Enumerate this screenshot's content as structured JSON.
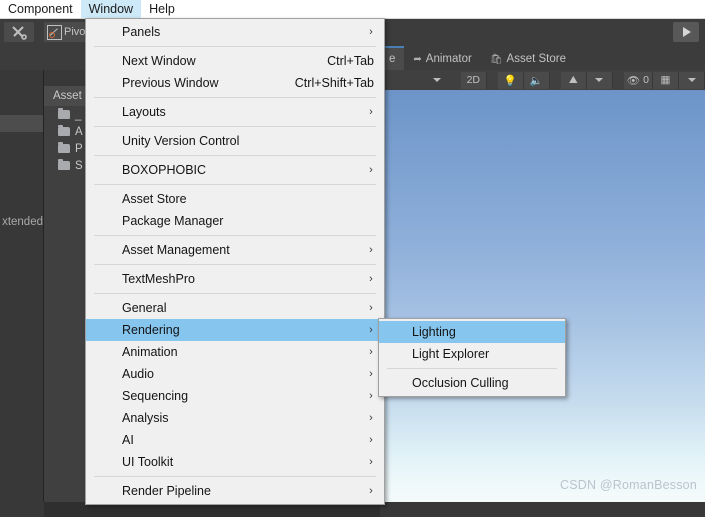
{
  "menubar": {
    "items": [
      {
        "label": "Component",
        "active": false
      },
      {
        "label": "Window",
        "active": true
      },
      {
        "label": "Help",
        "active": false
      }
    ]
  },
  "toolbar": {
    "tools_icon": "tools-icon",
    "pivot_label": "Pivo",
    "play_icon": "play-icon"
  },
  "tabs": [
    {
      "label": "e",
      "icon": "",
      "selected": true
    },
    {
      "label": "Animator",
      "icon": "animator-icon",
      "selected": false
    },
    {
      "label": "Asset Store",
      "icon": "asset-store-icon",
      "selected": false
    }
  ],
  "scene_toolbar": {
    "buttons": [
      {
        "name": "draw-mode-dropdown",
        "glyph": "caret"
      },
      {
        "name": "toggle-2d",
        "glyph": "2D"
      },
      {
        "name": "scene-lighting-toggle",
        "glyph": "lightbulb"
      },
      {
        "name": "scene-audio-toggle",
        "glyph": "speaker"
      },
      {
        "name": "fx-toggle",
        "glyph": "fx"
      },
      {
        "name": "fx-dropdown",
        "glyph": "caret"
      },
      {
        "name": "scene-visibility-toggle",
        "glyph": "eye-off",
        "count": "0"
      },
      {
        "name": "grid-toggle",
        "glyph": "grid"
      },
      {
        "name": "grid-dropdown",
        "glyph": "caret"
      }
    ]
  },
  "project_panel": {
    "tab_label": "Asset",
    "rows": [
      {
        "label": "_"
      },
      {
        "label": "A"
      },
      {
        "label": "P"
      },
      {
        "label": "S"
      }
    ],
    "side_label": "xtended"
  },
  "scene": {
    "watermark": "CSDN @RomanBesson",
    "sky_top_color": "#6d94c8",
    "sky_bottom_color": "#f4fbfb"
  },
  "window_menu": {
    "highlight_color": "#86c5ee",
    "items": [
      {
        "type": "item",
        "label": "Panels",
        "accel": "",
        "arrow": true,
        "highlighted": false
      },
      {
        "type": "sep"
      },
      {
        "type": "item",
        "label": "Next Window",
        "accel": "Ctrl+Tab",
        "arrow": false,
        "highlighted": false
      },
      {
        "type": "item",
        "label": "Previous Window",
        "accel": "Ctrl+Shift+Tab",
        "arrow": false,
        "highlighted": false
      },
      {
        "type": "sep"
      },
      {
        "type": "item",
        "label": "Layouts",
        "accel": "",
        "arrow": true,
        "highlighted": false
      },
      {
        "type": "sep"
      },
      {
        "type": "item",
        "label": "Unity Version Control",
        "accel": "",
        "arrow": false,
        "highlighted": false
      },
      {
        "type": "sep"
      },
      {
        "type": "item",
        "label": "BOXOPHOBIC",
        "accel": "",
        "arrow": true,
        "highlighted": false
      },
      {
        "type": "sep"
      },
      {
        "type": "item",
        "label": "Asset Store",
        "accel": "",
        "arrow": false,
        "highlighted": false
      },
      {
        "type": "item",
        "label": "Package Manager",
        "accel": "",
        "arrow": false,
        "highlighted": false
      },
      {
        "type": "sep"
      },
      {
        "type": "item",
        "label": "Asset Management",
        "accel": "",
        "arrow": true,
        "highlighted": false
      },
      {
        "type": "sep"
      },
      {
        "type": "item",
        "label": "TextMeshPro",
        "accel": "",
        "arrow": true,
        "highlighted": false
      },
      {
        "type": "sep"
      },
      {
        "type": "item",
        "label": "General",
        "accel": "",
        "arrow": true,
        "highlighted": false
      },
      {
        "type": "item",
        "label": "Rendering",
        "accel": "",
        "arrow": true,
        "highlighted": true
      },
      {
        "type": "item",
        "label": "Animation",
        "accel": "",
        "arrow": true,
        "highlighted": false
      },
      {
        "type": "item",
        "label": "Audio",
        "accel": "",
        "arrow": true,
        "highlighted": false
      },
      {
        "type": "item",
        "label": "Sequencing",
        "accel": "",
        "arrow": true,
        "highlighted": false
      },
      {
        "type": "item",
        "label": "Analysis",
        "accel": "",
        "arrow": true,
        "highlighted": false
      },
      {
        "type": "item",
        "label": "AI",
        "accel": "",
        "arrow": true,
        "highlighted": false
      },
      {
        "type": "item",
        "label": "UI Toolkit",
        "accel": "",
        "arrow": true,
        "highlighted": false
      },
      {
        "type": "sep"
      },
      {
        "type": "item",
        "label": "Render Pipeline",
        "accel": "",
        "arrow": true,
        "highlighted": false
      }
    ]
  },
  "rendering_submenu": {
    "items": [
      {
        "type": "item",
        "label": "Lighting",
        "accel": "",
        "arrow": false,
        "highlighted": true
      },
      {
        "type": "item",
        "label": "Light Explorer",
        "accel": "",
        "arrow": false,
        "highlighted": false
      },
      {
        "type": "sep"
      },
      {
        "type": "item",
        "label": "Occlusion Culling",
        "accel": "",
        "arrow": false,
        "highlighted": false
      }
    ]
  }
}
